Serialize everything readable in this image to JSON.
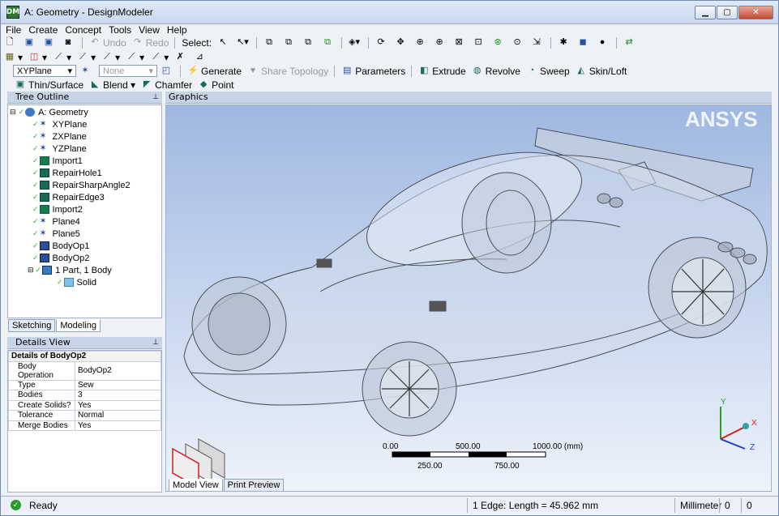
{
  "window": {
    "title": "A: Geometry - DesignModeler",
    "icon_text": "DM"
  },
  "menu": [
    "File",
    "Create",
    "Concept",
    "Tools",
    "View",
    "Help"
  ],
  "toolbar1": {
    "undo": "Undo",
    "redo": "Redo",
    "select_label": "Select:"
  },
  "toolbar3": {
    "plane": "XYPlane",
    "sketch": "None",
    "generate": "Generate",
    "share_topology": "Share Topology",
    "parameters": "Parameters",
    "extrude": "Extrude",
    "revolve": "Revolve",
    "sweep": "Sweep",
    "skin_loft": "Skin/Loft"
  },
  "toolbar4": {
    "thin_surface": "Thin/Surface",
    "blend": "Blend",
    "chamfer": "Chamfer",
    "point": "Point"
  },
  "tree_outline": {
    "title": "Tree Outline",
    "items": [
      {
        "label": "A: Geometry",
        "icon": "geometry-icon"
      },
      {
        "label": "XYPlane",
        "icon": "plane-icon"
      },
      {
        "label": "ZXPlane",
        "icon": "plane-icon"
      },
      {
        "label": "YZPlane",
        "icon": "plane-icon"
      },
      {
        "label": "Import1",
        "icon": "import-icon"
      },
      {
        "label": "RepairHole1",
        "icon": "repair-icon"
      },
      {
        "label": "RepairSharpAngle2",
        "icon": "repair-icon"
      },
      {
        "label": "RepairEdge3",
        "icon": "repair-icon"
      },
      {
        "label": "Import2",
        "icon": "import-icon"
      },
      {
        "label": "Plane4",
        "icon": "plane-icon"
      },
      {
        "label": "Plane5",
        "icon": "plane-icon"
      },
      {
        "label": "BodyOp1",
        "icon": "body-op-icon"
      },
      {
        "label": "BodyOp2",
        "icon": "body-op-icon"
      },
      {
        "label": "1 Part, 1 Body",
        "icon": "part-icon"
      },
      {
        "label": "Solid",
        "icon": "solid-icon"
      }
    ],
    "tabs": [
      "Sketching",
      "Modeling"
    ]
  },
  "details_view": {
    "title": "Details View",
    "header": "Details of BodyOp2",
    "rows": [
      {
        "key": "Body Operation",
        "value": "BodyOp2"
      },
      {
        "key": "Type",
        "value": "Sew"
      },
      {
        "key": "Bodies",
        "value": "3"
      },
      {
        "key": "Create Solids?",
        "value": "Yes"
      },
      {
        "key": "Tolerance",
        "value": "Normal"
      },
      {
        "key": "Merge Bodies",
        "value": "Yes"
      }
    ]
  },
  "graphics": {
    "title": "Graphics",
    "logo": "ANSYS",
    "scale_labels_top": [
      "0.00",
      "500.00",
      "1000.00 (mm)"
    ],
    "scale_labels_bottom": [
      "250.00",
      "750.00"
    ],
    "axes": {
      "x": "X",
      "y": "Y",
      "z": "Z"
    },
    "tabs": [
      "Model View",
      "Print Preview"
    ]
  },
  "status": {
    "state": "Ready",
    "selection": "1 Edge: Length = 45.962 mm",
    "units": "Millimeter",
    "v1": "0",
    "v2": "0"
  }
}
